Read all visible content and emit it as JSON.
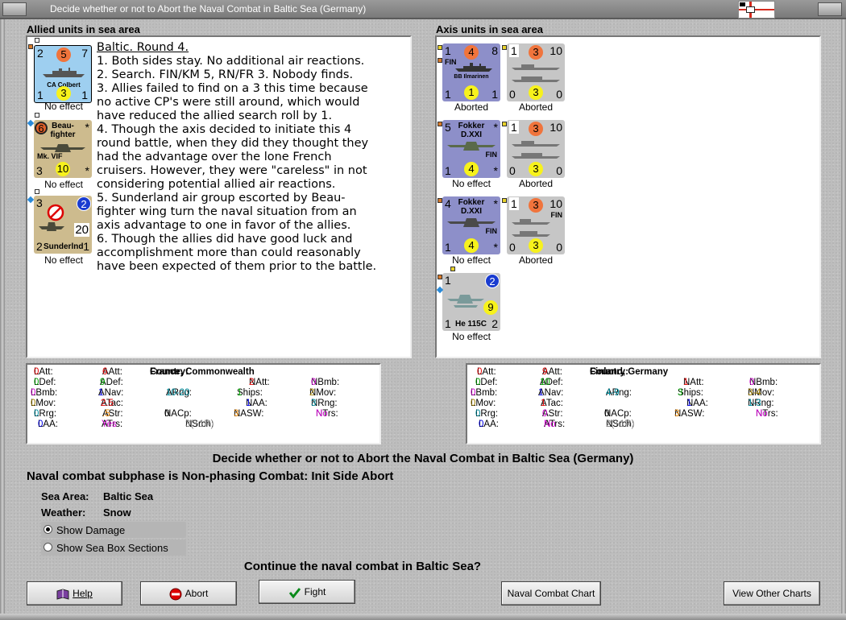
{
  "window": {
    "title": "Decide whether or not to Abort the Naval Combat in Baltic Sea (Germany)"
  },
  "allied": {
    "section_label": "Allied units in sea area",
    "units": [
      {
        "top_left": "2",
        "circle": "5",
        "top_right": "7",
        "name": "CA Colbert",
        "bottom_left": "1",
        "bottom_circle": "3",
        "bottom_right": "1",
        "status": "No effect"
      },
      {
        "top_left": "6",
        "name_line1": "Beau-",
        "name_line2": "fighter",
        "top_right": "*",
        "model": "Mk. VIF",
        "bottom_left": "3",
        "bottom_circle": "10",
        "bottom_right": "*",
        "status": "No effect"
      },
      {
        "top_left": "3",
        "circle": "2",
        "value": "20",
        "bottom_left": "2",
        "name": "Sunderlnd",
        "bottom_right": "1",
        "status": "No effect"
      }
    ],
    "notes": [
      "Baltic.  Round 4.",
      "1.  Both sides stay.  No additional air reactions.",
      "2.  Search.  FIN/KM 5, RN/FR 3.  Nobody finds.",
      "3.  Allies failed to find on a 3 this time because",
      "no active CP's were still around, which would",
      "have reduced the allied search roll by 1.",
      "4.  Though the axis decided to initiate this 4",
      "round battle, when they did they thought they",
      "had the advantage over the lone French",
      "cruisers.  However, they were \"careless\" in not",
      "considering potential allied air reactions.",
      "5.  Sunderland air group escorted by Beau-",
      "fighter wing turn the naval situation from an",
      "axis advantage to one in favor of the allies.",
      "6.  Though the allies did have good luck and",
      "accomplishment more than could reasonably",
      "have been expected of them prior to the battle."
    ],
    "stats": {
      "country_label": "Country:",
      "country": "France, Commonwealth",
      "LAtt": "0",
      "AAtt": "6",
      "NAtt": "2",
      "NBmb": "0",
      "LDef": "0",
      "ADef": "9",
      "NMov": "2",
      "LBmb": "0",
      "ANav": "1",
      "ARng": "10-20",
      "Ships": "1",
      "LMov": "0",
      "ATac": "2.5",
      "NAA": "1",
      "NRng": "3",
      "LRrg": "0",
      "AStr": ".5",
      "NACp": "0",
      "NASW": "3",
      "NTrs": "No",
      "LAA": "0",
      "ATrs": "Yes",
      "NSrch": "3(+1R)"
    }
  },
  "axis": {
    "section_label": "Axis units in sea area",
    "units": [
      {
        "top_left": "1",
        "circle": "4",
        "top_right": "8",
        "tag": "FIN",
        "name": "BB Ilmarinen",
        "bottom_left": "1",
        "bottom_circle": "1",
        "bottom_right": "1",
        "status": "Aborted"
      },
      {
        "top_left": "1",
        "circle": "3",
        "top_right": "10",
        "bottom_left": "0",
        "bottom_circle": "3",
        "bottom_right": "0",
        "status": "Aborted"
      },
      {
        "top_left": "5",
        "name_line1": "Fokker",
        "name_line2": "D.XXI",
        "top_right": "*",
        "tag": "FIN",
        "bottom_left": "1",
        "bottom_circle": "4",
        "bottom_right": "*",
        "status": "No effect"
      },
      {
        "top_left": "1",
        "circle": "3",
        "top_right": "10",
        "bottom_left": "0",
        "bottom_circle": "3",
        "bottom_right": "0",
        "status": "Aborted"
      },
      {
        "top_left": "4",
        "name_line1": "Fokker",
        "name_line2": "D.XXI",
        "top_right": "*",
        "tag": "FIN",
        "bottom_left": "1",
        "bottom_circle": "4",
        "bottom_right": "*",
        "status": "No effect"
      },
      {
        "top_left": "1",
        "circle": "3",
        "top_right": "10",
        "tag": "FIN",
        "bottom_left": "0",
        "bottom_circle": "3",
        "bottom_right": "0",
        "status": "Aborted"
      },
      {
        "top_left": "1",
        "circle": "2",
        "value": "9",
        "bottom_left": "1",
        "name": "He 115C",
        "bottom_right": "2",
        "status": "No effect"
      }
    ],
    "stats": {
      "country_label": "Country:",
      "country": "Finland, Germany",
      "LAtt": "0",
      "AAtt": "9",
      "NAtt": "1",
      "NBmb": "0",
      "LDef": "0",
      "ADef": "10",
      "NMov": "3-4",
      "LBmb": "0",
      "ANav": "1",
      "ARng": "4-9",
      "Ships": "3",
      "LMov": "0",
      "ATac": "1",
      "NAA": "1",
      "NRng": "1-3",
      "LRrg": "0",
      "AStr": "0",
      "NACp": "0",
      "NASW": "3",
      "NTrs": "No",
      "LAA": "0",
      "ATrs": "No",
      "NSrch": "2(+1R)"
    }
  },
  "decision": {
    "heading": "Decide whether or not to Abort the Naval Combat in Baltic Sea (Germany)",
    "subphase": "Naval combat subphase is Non-phasing Combat: Init Side Abort",
    "sea_area_label": "Sea Area:",
    "sea_area": "Baltic Sea",
    "weather_label": "Weather:",
    "weather": "Snow",
    "show_damage": "Show Damage",
    "show_sea_box": "Show Sea Box Sections",
    "question": "Continue the naval combat in Baltic Sea?"
  },
  "buttons": {
    "help": "Help",
    "abort": "Abort",
    "fight": "Fight",
    "naval_chart": "Naval Combat Chart",
    "view_charts": "View Other Charts"
  },
  "icons": {
    "help": "book-icon",
    "abort": "no-entry-icon",
    "fight": "checkmark-icon",
    "flag": "german-naval-ensign-icon"
  }
}
